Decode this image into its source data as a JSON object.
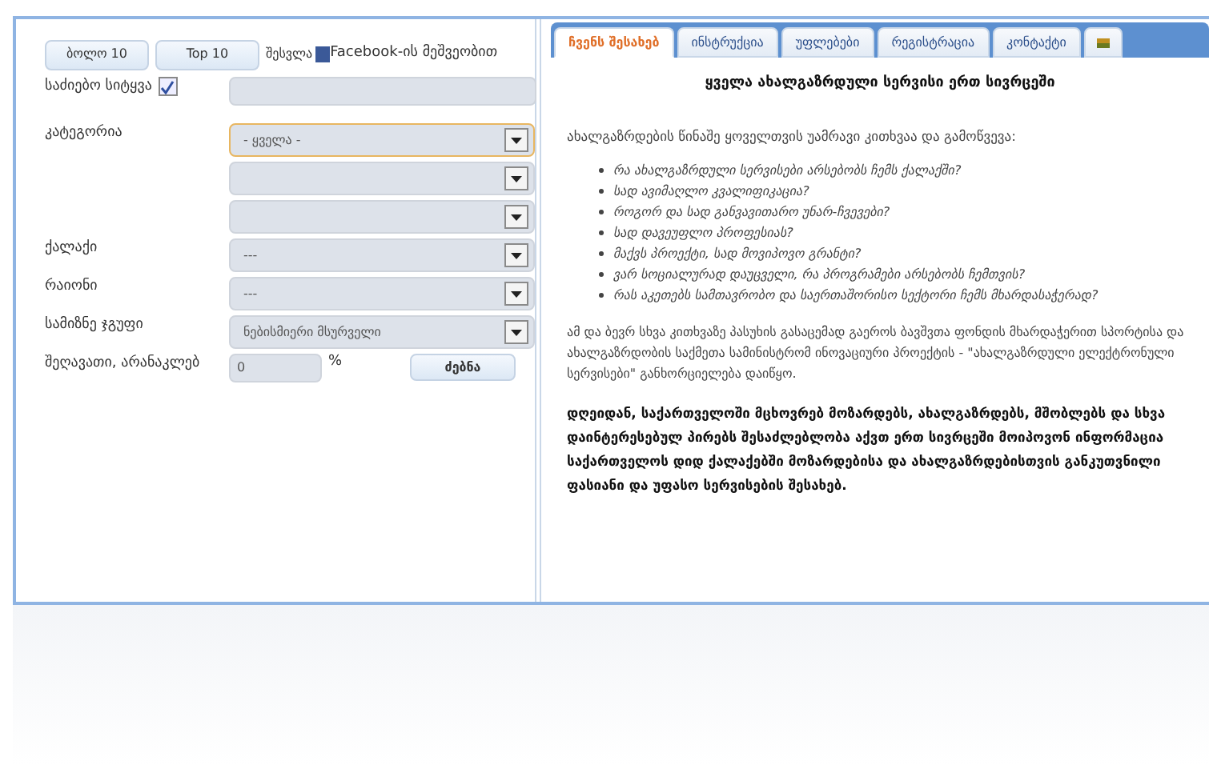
{
  "top_buttons": [
    "ბოლო 10",
    "Top 10"
  ],
  "facebook_login": {
    "prefix": "შესვლა",
    "brand": "Facebook",
    "suffix": "-ის მეშვეობით"
  },
  "form": [
    {
      "kind": "text",
      "label": "საძიებო სიტყვა",
      "checked": true
    },
    {
      "kind": "select",
      "label": "კატეგორია",
      "value": "- ყველა -",
      "focused": true
    },
    {
      "kind": "select",
      "focused": false
    },
    {
      "kind": "select",
      "focused": false
    },
    {
      "kind": "select",
      "label": "ქალაქი",
      "value": "---",
      "focused": false
    },
    {
      "kind": "select",
      "label": "რაიონი",
      "value": "---",
      "focused": false
    },
    {
      "kind": "select",
      "label": "სამიზნე ჯგუფი",
      "value": "ნებისმიერი მსურველი",
      "focused": false
    },
    {
      "kind": "percent",
      "label": "შეღავათი, არანაკლებ",
      "value": "0",
      "unit": "%",
      "button": "ძებნა"
    }
  ],
  "tabs": [
    {
      "label": "ჩვენს შესახებ",
      "selected": true
    },
    {
      "label": "ინსტრუქცია",
      "selected": false
    },
    {
      "label": "უფლებები",
      "selected": false
    },
    {
      "label": "რეგისტრაცია",
      "selected": false
    },
    {
      "label": "კონტაქტი",
      "selected": false
    },
    {
      "kind": "flag",
      "selected": false
    }
  ],
  "article": {
    "heading": "ყველა ახალგაზრდული სერვისი ერთ სივრცეში",
    "intro": "ახალგაზრდების წინაშე ყოველთვის უამრავი კითხვაა და გამოწვევა:",
    "questions": [
      "რა ახალგაზრდული სერვისები არსებობს ჩემს ქალაქში?",
      "სად ავიმაღლო კვალიფიკაცია?",
      "როგორ და სად განვავითარო უნარ-ჩვევები?",
      "სად დავეუფლო პროფესიას?",
      "მაქვს პროექტი, სად მოვიპოვო გრანტი?",
      "ვარ სოციალურად დაუცველი, რა პროგრამები არსებობს ჩემთვის?",
      "რას აკეთებს სამთავრობო და საერთაშორისო სექტორი ჩემს მხარდასაჭერად?"
    ],
    "paragraph": "ამ და ბევრ სხვა კითხვაზე პასუხის გასაცემად გაეროს ბავშვთა ფონდის მხარდაჭერით სპორტისა და ახალგაზრდობის საქმეთა სამინისტრომ ინოვაციური პროექტის - \"ახალგაზრდული ელექტრონული სერვისები\" განხორციელება დაიწყო.",
    "bold_paragraph": "დღეიდან, საქართველოში მცხოვრებ მოზარდებს, ახალგაზრდებს, მშობლებს და სხვა დაინტერესებულ პირებს შესაძლებლობა აქვთ ერთ სივრცეში მოიპოვონ ინფორმაცია საქართველოს დიდ ქალაქებში მოზარდებისა და ახალგაზრდებისთვის განკუთვნილი ფასიანი და უფასო სერვისების შესახებ."
  }
}
